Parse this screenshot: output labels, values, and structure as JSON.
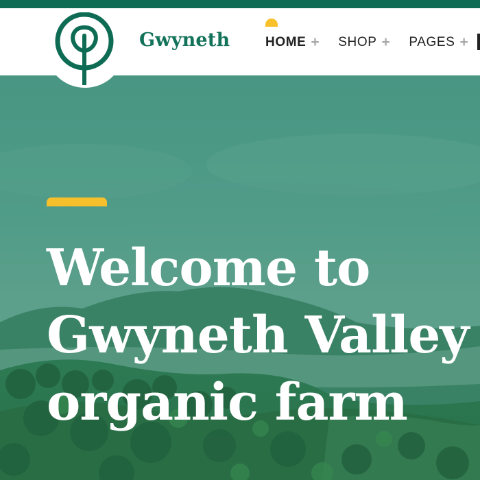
{
  "brand": {
    "name": "Gwyneth",
    "logo_icon": "tree-icon"
  },
  "nav": {
    "items": [
      {
        "label": "HOME",
        "active": true,
        "expand_icon": "plus-icon"
      },
      {
        "label": "SHOP",
        "active": false,
        "expand_icon": "plus-icon"
      },
      {
        "label": "PAGES",
        "active": false,
        "expand_icon": "plus-icon"
      }
    ],
    "expand_symbol": "+"
  },
  "hero": {
    "title_lines": [
      "Welcome to",
      "Gwyneth Valley",
      "organic farm"
    ]
  },
  "colors": {
    "brand_green": "#0e6b54",
    "brand_text": "#13725a",
    "accent_yellow": "#f6c02c",
    "hero_overlay": "#4f9a86"
  }
}
